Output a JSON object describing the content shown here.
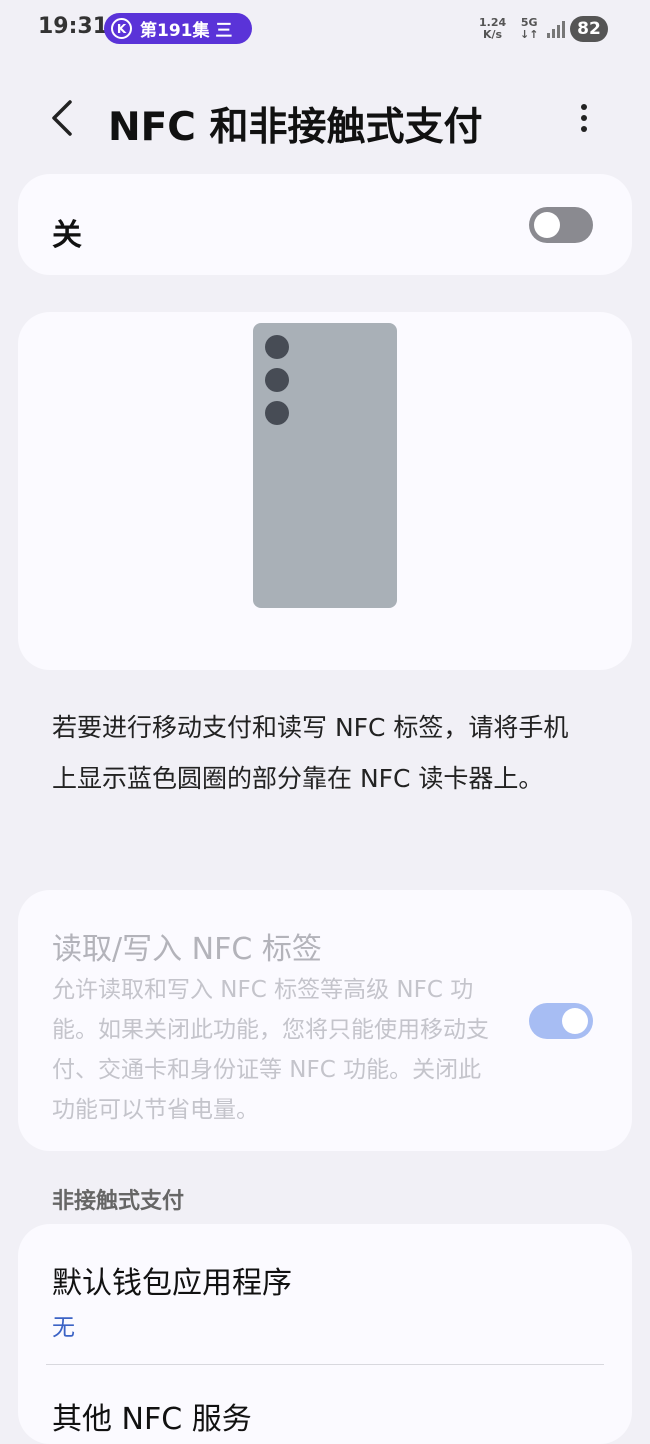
{
  "status_bar": {
    "time": "19:31",
    "media_icon_letter": "K",
    "media_pill": "第191集 三",
    "net_speed_value": "1.24",
    "net_speed_unit": "K/s",
    "network_type": "5G",
    "network_arrows": "↓↑",
    "battery": "82",
    "pill_color": "#5A33D8"
  },
  "header": {
    "title": "NFC 和非接触式支付"
  },
  "master_switch": {
    "label": "关",
    "enabled": false
  },
  "description": "若要进行移动支付和读写 NFC 标签，请将手机上显示蓝色圆圈的部分靠在 NFC 读卡器上。",
  "read_write_tags": {
    "title": "读取/写入 NFC 标签",
    "description": "允许读取和写入 NFC 标签等高级 NFC 功能。如果关闭此功能，您将只能使用移动支付、交通卡和身份证等 NFC 功能。关闭此功能可以节省电量。",
    "enabled": true,
    "disabled_state": true
  },
  "contactless_section": {
    "header": "非接触式支付",
    "default_wallet": {
      "title": "默认钱包应用程序",
      "value": "无"
    },
    "other_services": {
      "title": "其他 NFC 服务"
    }
  },
  "colors": {
    "background": "#F1F0F6",
    "card": "#FBFAFF",
    "accent_link": "#3C63C5",
    "toggle_on_disabled": "#A7BDF3",
    "toggle_off": "#8A8A90",
    "phone_illustration": "#A9B0B7"
  }
}
